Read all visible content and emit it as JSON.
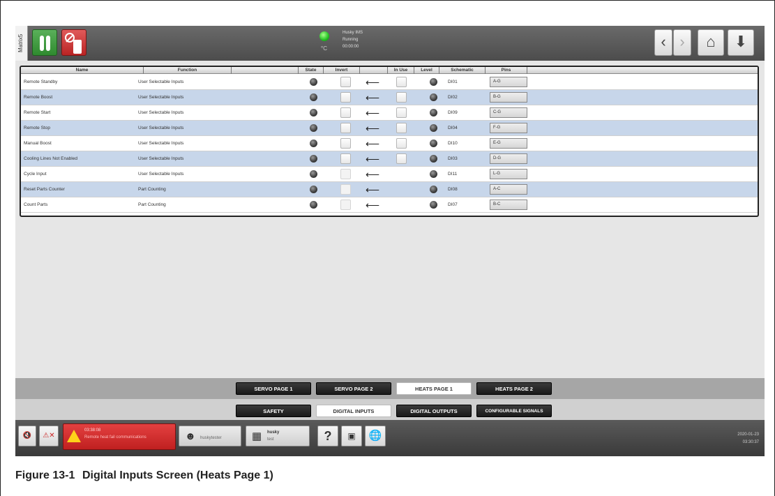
{
  "window": {
    "side_tab": "Matrix5"
  },
  "topbar": {
    "status_title": "Husky IMS",
    "status_state": "Running",
    "status_time": "00:00:00",
    "temp_unit": "°C",
    "icons": [
      "heats-thermometer-icon",
      "no-lubricant-bottle-icon",
      "chevron-left-icon",
      "chevron-right-icon",
      "home-icon",
      "down-arrow-icon"
    ],
    "colors": {
      "green_button": "#2f8a2f",
      "red_button": "#b92424",
      "status_led": "#22c022"
    }
  },
  "table": {
    "headers": {
      "name": "Name",
      "function": "Function",
      "blank": "",
      "state": "State",
      "invert": "Invert",
      "in_use": "In Use",
      "level": "Level",
      "schematic": "Schematic",
      "pins": "Pins"
    },
    "rows": [
      {
        "name": "Remote Standby",
        "function": "User Selectable Inputs",
        "schematic": "DI01",
        "pins": "A-G"
      },
      {
        "name": "Remote Boost",
        "function": "User Selectable Inputs",
        "schematic": "DI02",
        "pins": "B-G"
      },
      {
        "name": "Remote Start",
        "function": "User Selectable Inputs",
        "schematic": "DI09",
        "pins": "C-G"
      },
      {
        "name": "Remote Stop",
        "function": "User Selectable Inputs",
        "schematic": "DI04",
        "pins": "F-G"
      },
      {
        "name": "Manual Boost",
        "function": "User Selectable Inputs",
        "schematic": "DI10",
        "pins": "E-G"
      },
      {
        "name": "Cooling Lines Not Enabled",
        "function": "User Selectable Inputs",
        "schematic": "DI03",
        "pins": "D-G"
      },
      {
        "name": "Cycle Input",
        "function": "User Selectable Inputs",
        "schematic": "DI11",
        "pins": "L-G"
      },
      {
        "name": "Reset Parts Counter",
        "function": "Part Counting",
        "schematic": "DI08",
        "pins": "A-C"
      },
      {
        "name": "Count Parts",
        "function": "Part Counting",
        "schematic": "DI07",
        "pins": "B-C"
      }
    ],
    "row_colors": {
      "alt": "#c7d6ea",
      "plain": "#ffffff"
    }
  },
  "nav": {
    "pages": [
      {
        "label": "SERVO PAGE 1",
        "active": false
      },
      {
        "label": "SERVO PAGE 2",
        "active": false
      },
      {
        "label": "HEATS PAGE 1",
        "active": true
      },
      {
        "label": "HEATS PAGE 2",
        "active": false
      }
    ],
    "sections": [
      {
        "label": "SAFETY",
        "active": false
      },
      {
        "label": "DIGITAL INPUTS",
        "active": true
      },
      {
        "label": "DIGITAL OUTPUTS",
        "active": false
      },
      {
        "label": "CONFIGURABLE SIGNALS",
        "active": false
      }
    ]
  },
  "footer": {
    "alarm_time": "03:38:08",
    "alarm_message": "Remote heat fail communications",
    "user_name": "huskytester",
    "mold_title": "husky",
    "mold_sub": "test",
    "date": "2020-01-23",
    "time": "03:30:37",
    "icons": [
      "mute-icon",
      "clear-alarms-icon",
      "alarm-warning-icon",
      "user-icon",
      "mold-icon",
      "help-icon",
      "screenshot-icon",
      "globe-icon"
    ]
  },
  "caption": {
    "number": "Figure 13-1",
    "title": "Digital Inputs Screen (Heats Page 1)"
  }
}
